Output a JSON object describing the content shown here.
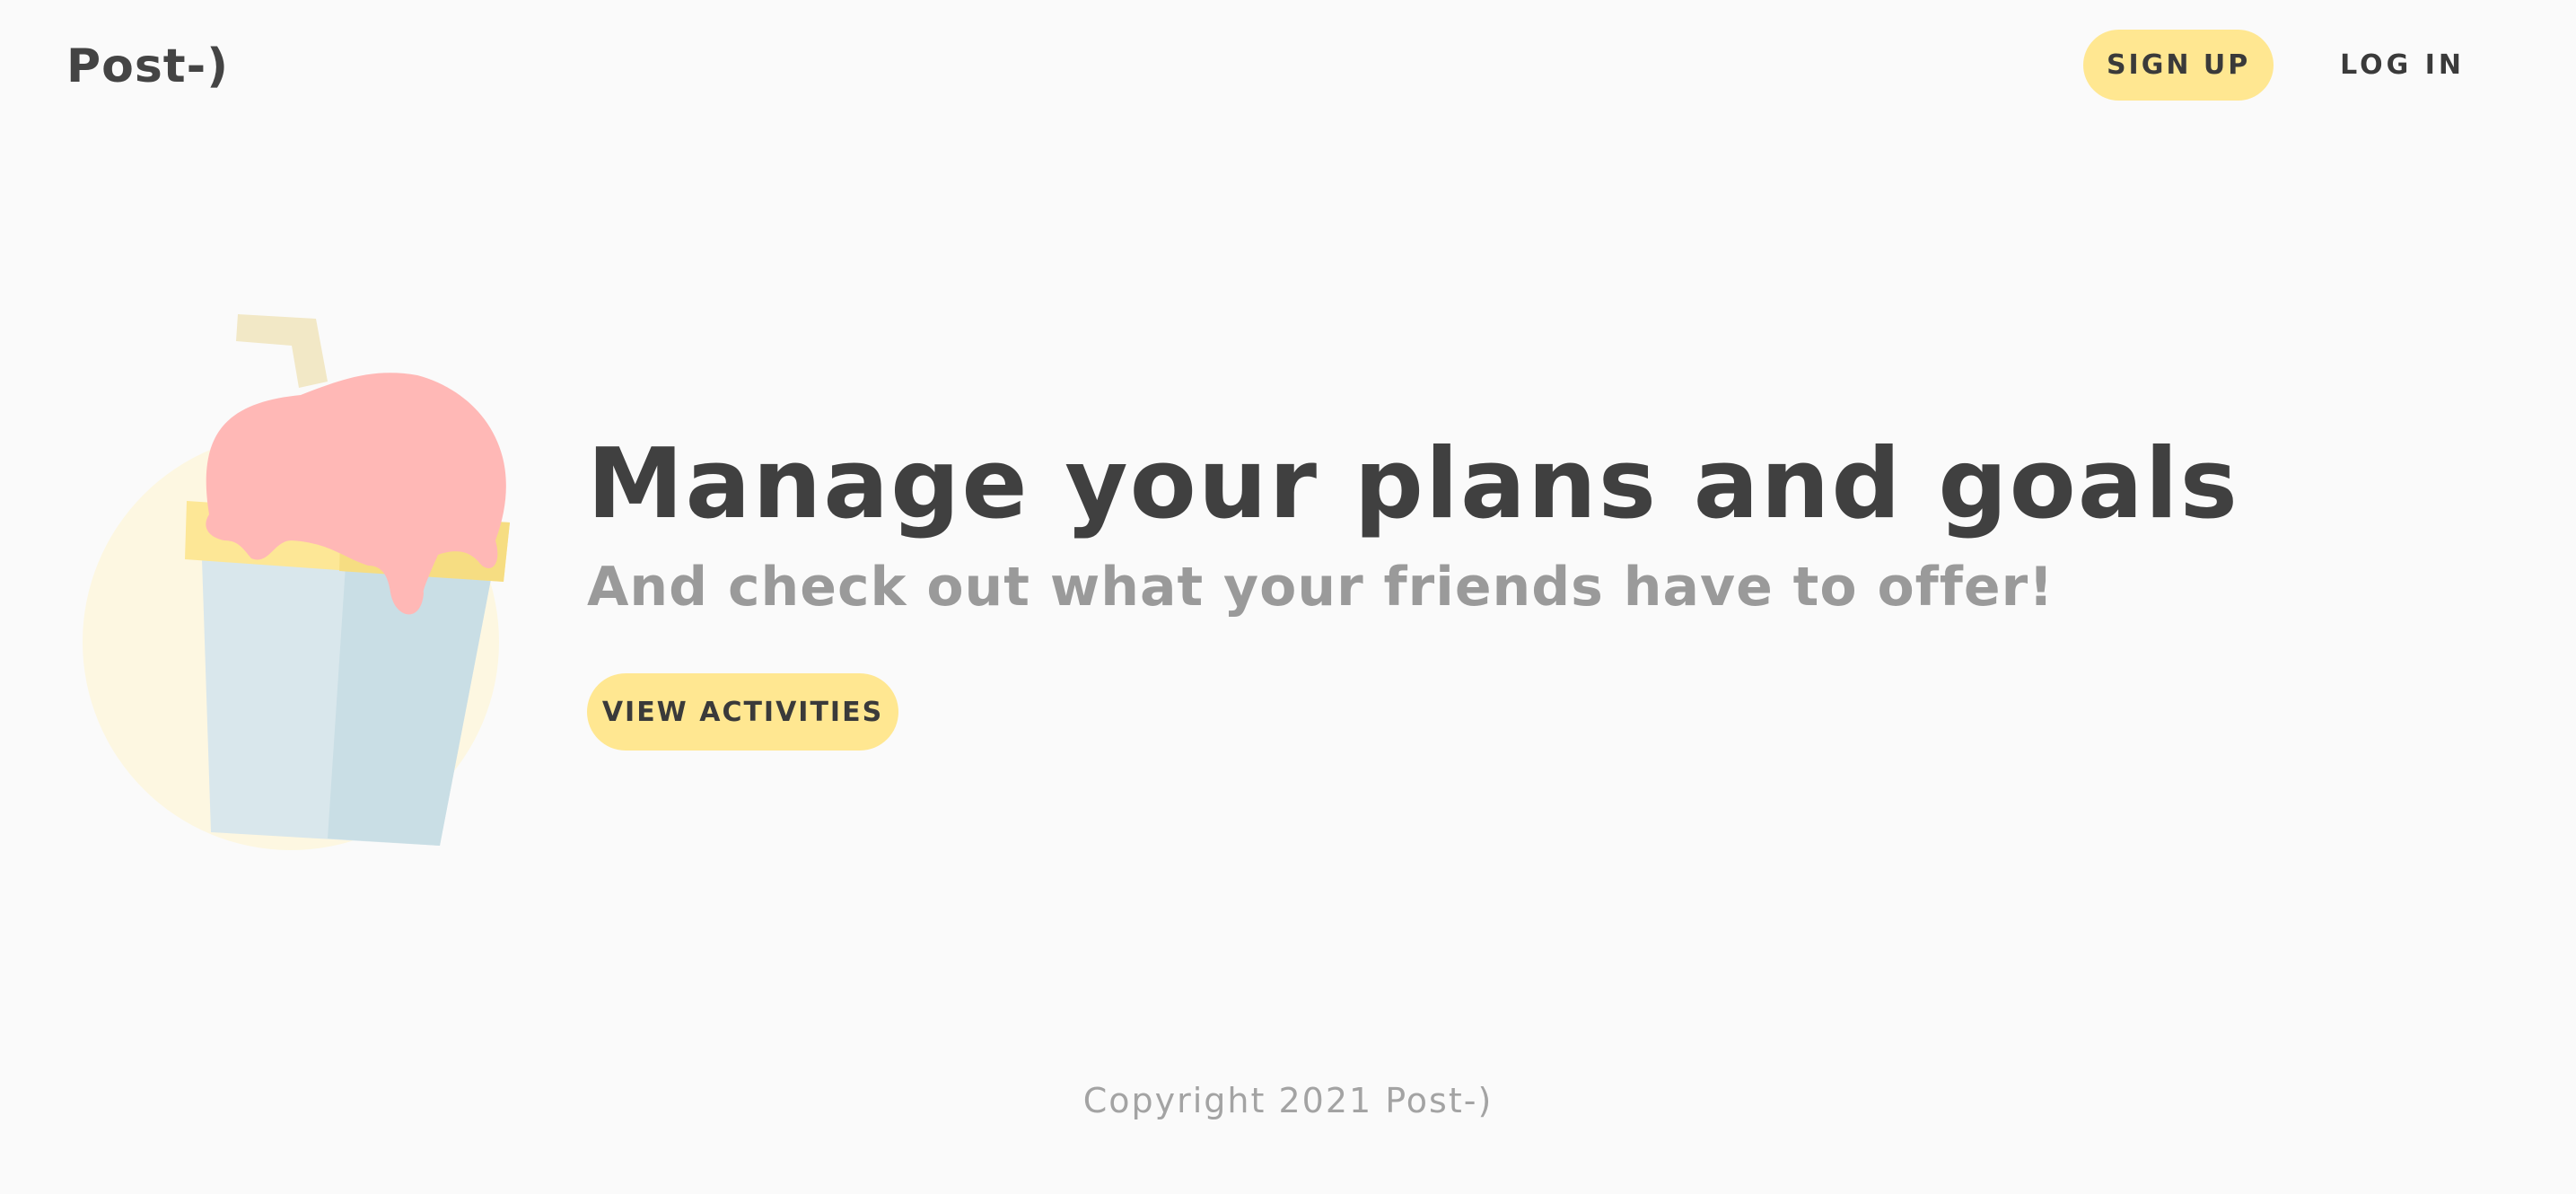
{
  "header": {
    "logo": "Post-)",
    "signup_label": "SIGN UP",
    "login_label": "LOG IN"
  },
  "hero": {
    "title": "Manage your plans and goals",
    "subtitle": "And check out what your friends have to offer!",
    "cta_label": "VIEW ACTIVITIES",
    "illustration_icon": "ice-cream-cup-icon"
  },
  "footer": {
    "copyright": "Copyright 2021 Post-)"
  },
  "colors": {
    "background": "#fafafa",
    "accent": "#ffe791",
    "text_dark": "#424242",
    "text_muted": "#9a9a9a"
  }
}
